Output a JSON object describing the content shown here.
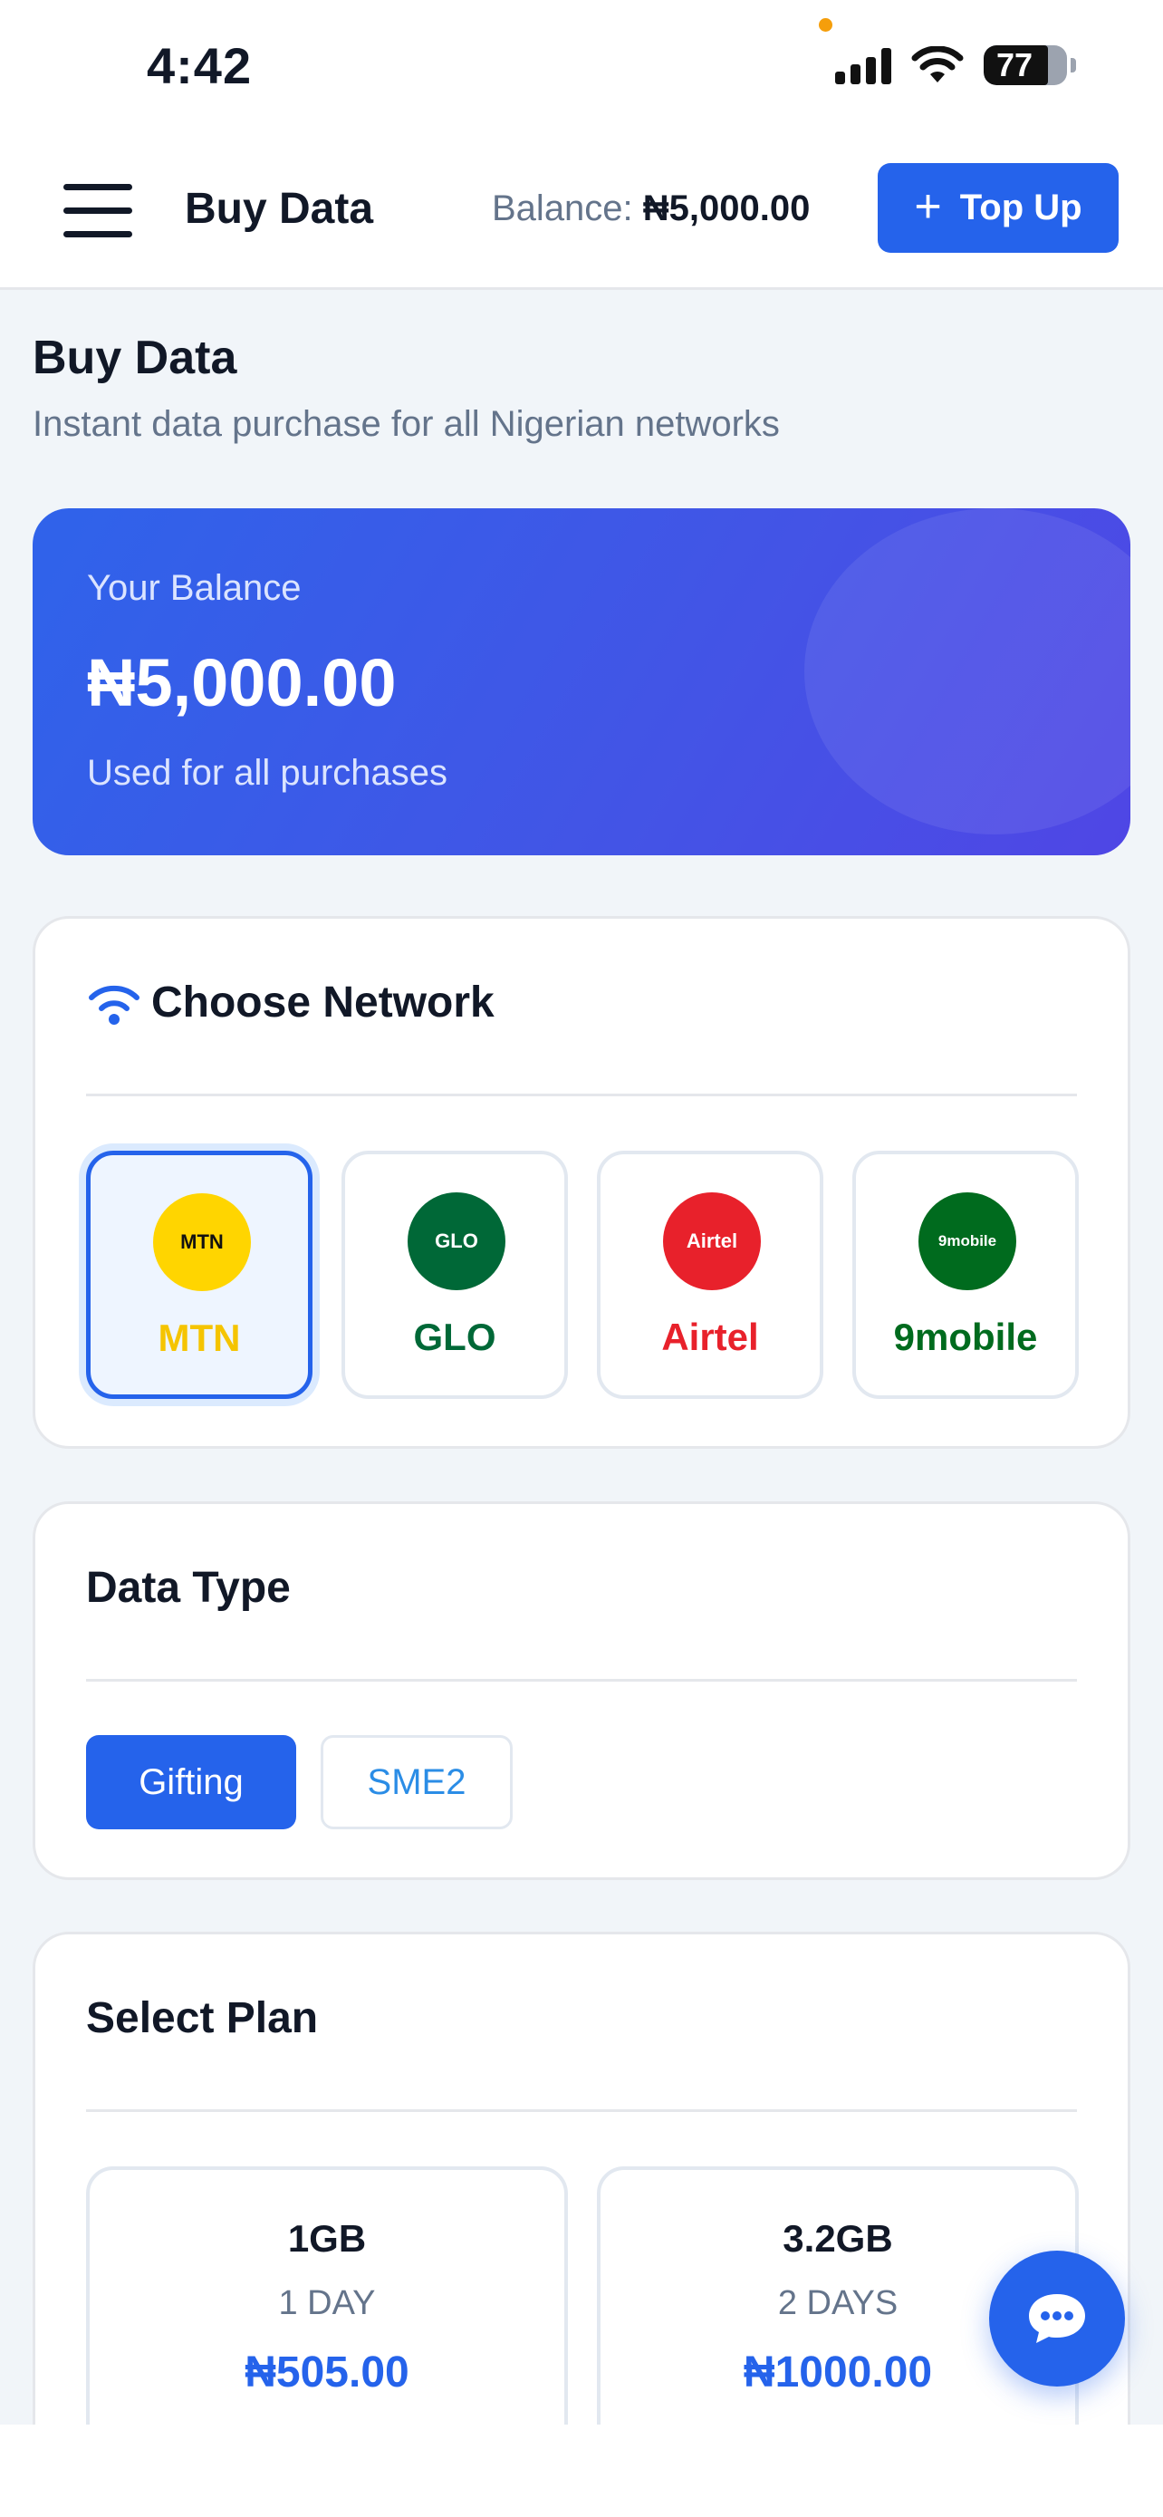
{
  "status_bar": {
    "time": "4:42",
    "battery_level": "77",
    "battery_fraction": 0.77
  },
  "header": {
    "title": "Buy Data",
    "balance_label": "Balance:",
    "balance_value": "₦5,000.00",
    "topup_label": "Top Up",
    "menu_icon": "hamburger-icon",
    "topup_icon": "plus-icon"
  },
  "page": {
    "title": "Buy Data",
    "subtitle": "Instant data purchase for all Nigerian networks"
  },
  "balance_card": {
    "label": "Your Balance",
    "amount": "₦5,000.00",
    "note": "Used for all purchases"
  },
  "network_section": {
    "title": "Choose Network",
    "icon": "wifi-icon",
    "selected": "MTN",
    "networks": [
      {
        "logo_text": "MTN",
        "name": "MTN",
        "logo_color": "#ffd500",
        "logo_text_color": "#111111",
        "name_color": "#f5c400"
      },
      {
        "logo_text": "GLO",
        "name": "GLO",
        "logo_color": "#006837",
        "logo_text_color": "#ffffff",
        "name_color": "#006837"
      },
      {
        "logo_text": "Airtel",
        "name": "Airtel",
        "logo_color": "#e8212b",
        "logo_text_color": "#ffffff",
        "name_color": "#e8212b"
      },
      {
        "logo_text": "9mobile",
        "name": "9mobile",
        "logo_color": "#006b1e",
        "logo_text_color": "#ffffff",
        "name_color": "#006b1e"
      }
    ]
  },
  "data_type_section": {
    "title": "Data Type",
    "selected": "Gifting",
    "options": [
      "Gifting",
      "SME2"
    ]
  },
  "plan_section": {
    "title": "Select Plan",
    "plans": [
      {
        "size": "1GB",
        "duration": "1 DAY",
        "price": "₦505.00"
      },
      {
        "size": "3.2GB",
        "duration": "2 DAYS",
        "price": "₦1000.00"
      }
    ]
  },
  "chat_button": {
    "icon": "chat-bubble-icon"
  },
  "colors": {
    "primary": "#2563eb",
    "background": "#f1f5f9",
    "text": "#111827",
    "muted": "#64748b"
  }
}
